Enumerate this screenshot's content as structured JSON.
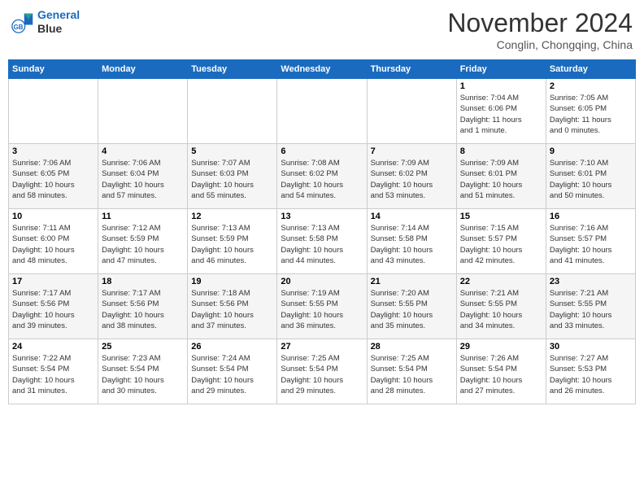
{
  "header": {
    "logo_line1": "General",
    "logo_line2": "Blue",
    "month": "November 2024",
    "location": "Conglin, Chongqing, China"
  },
  "weekdays": [
    "Sunday",
    "Monday",
    "Tuesday",
    "Wednesday",
    "Thursday",
    "Friday",
    "Saturday"
  ],
  "weeks": [
    [
      {
        "day": "",
        "info": ""
      },
      {
        "day": "",
        "info": ""
      },
      {
        "day": "",
        "info": ""
      },
      {
        "day": "",
        "info": ""
      },
      {
        "day": "",
        "info": ""
      },
      {
        "day": "1",
        "info": "Sunrise: 7:04 AM\nSunset: 6:06 PM\nDaylight: 11 hours\nand 1 minute."
      },
      {
        "day": "2",
        "info": "Sunrise: 7:05 AM\nSunset: 6:05 PM\nDaylight: 11 hours\nand 0 minutes."
      }
    ],
    [
      {
        "day": "3",
        "info": "Sunrise: 7:06 AM\nSunset: 6:05 PM\nDaylight: 10 hours\nand 58 minutes."
      },
      {
        "day": "4",
        "info": "Sunrise: 7:06 AM\nSunset: 6:04 PM\nDaylight: 10 hours\nand 57 minutes."
      },
      {
        "day": "5",
        "info": "Sunrise: 7:07 AM\nSunset: 6:03 PM\nDaylight: 10 hours\nand 55 minutes."
      },
      {
        "day": "6",
        "info": "Sunrise: 7:08 AM\nSunset: 6:02 PM\nDaylight: 10 hours\nand 54 minutes."
      },
      {
        "day": "7",
        "info": "Sunrise: 7:09 AM\nSunset: 6:02 PM\nDaylight: 10 hours\nand 53 minutes."
      },
      {
        "day": "8",
        "info": "Sunrise: 7:09 AM\nSunset: 6:01 PM\nDaylight: 10 hours\nand 51 minutes."
      },
      {
        "day": "9",
        "info": "Sunrise: 7:10 AM\nSunset: 6:01 PM\nDaylight: 10 hours\nand 50 minutes."
      }
    ],
    [
      {
        "day": "10",
        "info": "Sunrise: 7:11 AM\nSunset: 6:00 PM\nDaylight: 10 hours\nand 48 minutes."
      },
      {
        "day": "11",
        "info": "Sunrise: 7:12 AM\nSunset: 5:59 PM\nDaylight: 10 hours\nand 47 minutes."
      },
      {
        "day": "12",
        "info": "Sunrise: 7:13 AM\nSunset: 5:59 PM\nDaylight: 10 hours\nand 46 minutes."
      },
      {
        "day": "13",
        "info": "Sunrise: 7:13 AM\nSunset: 5:58 PM\nDaylight: 10 hours\nand 44 minutes."
      },
      {
        "day": "14",
        "info": "Sunrise: 7:14 AM\nSunset: 5:58 PM\nDaylight: 10 hours\nand 43 minutes."
      },
      {
        "day": "15",
        "info": "Sunrise: 7:15 AM\nSunset: 5:57 PM\nDaylight: 10 hours\nand 42 minutes."
      },
      {
        "day": "16",
        "info": "Sunrise: 7:16 AM\nSunset: 5:57 PM\nDaylight: 10 hours\nand 41 minutes."
      }
    ],
    [
      {
        "day": "17",
        "info": "Sunrise: 7:17 AM\nSunset: 5:56 PM\nDaylight: 10 hours\nand 39 minutes."
      },
      {
        "day": "18",
        "info": "Sunrise: 7:17 AM\nSunset: 5:56 PM\nDaylight: 10 hours\nand 38 minutes."
      },
      {
        "day": "19",
        "info": "Sunrise: 7:18 AM\nSunset: 5:56 PM\nDaylight: 10 hours\nand 37 minutes."
      },
      {
        "day": "20",
        "info": "Sunrise: 7:19 AM\nSunset: 5:55 PM\nDaylight: 10 hours\nand 36 minutes."
      },
      {
        "day": "21",
        "info": "Sunrise: 7:20 AM\nSunset: 5:55 PM\nDaylight: 10 hours\nand 35 minutes."
      },
      {
        "day": "22",
        "info": "Sunrise: 7:21 AM\nSunset: 5:55 PM\nDaylight: 10 hours\nand 34 minutes."
      },
      {
        "day": "23",
        "info": "Sunrise: 7:21 AM\nSunset: 5:55 PM\nDaylight: 10 hours\nand 33 minutes."
      }
    ],
    [
      {
        "day": "24",
        "info": "Sunrise: 7:22 AM\nSunset: 5:54 PM\nDaylight: 10 hours\nand 31 minutes."
      },
      {
        "day": "25",
        "info": "Sunrise: 7:23 AM\nSunset: 5:54 PM\nDaylight: 10 hours\nand 30 minutes."
      },
      {
        "day": "26",
        "info": "Sunrise: 7:24 AM\nSunset: 5:54 PM\nDaylight: 10 hours\nand 29 minutes."
      },
      {
        "day": "27",
        "info": "Sunrise: 7:25 AM\nSunset: 5:54 PM\nDaylight: 10 hours\nand 29 minutes."
      },
      {
        "day": "28",
        "info": "Sunrise: 7:25 AM\nSunset: 5:54 PM\nDaylight: 10 hours\nand 28 minutes."
      },
      {
        "day": "29",
        "info": "Sunrise: 7:26 AM\nSunset: 5:54 PM\nDaylight: 10 hours\nand 27 minutes."
      },
      {
        "day": "30",
        "info": "Sunrise: 7:27 AM\nSunset: 5:53 PM\nDaylight: 10 hours\nand 26 minutes."
      }
    ]
  ]
}
